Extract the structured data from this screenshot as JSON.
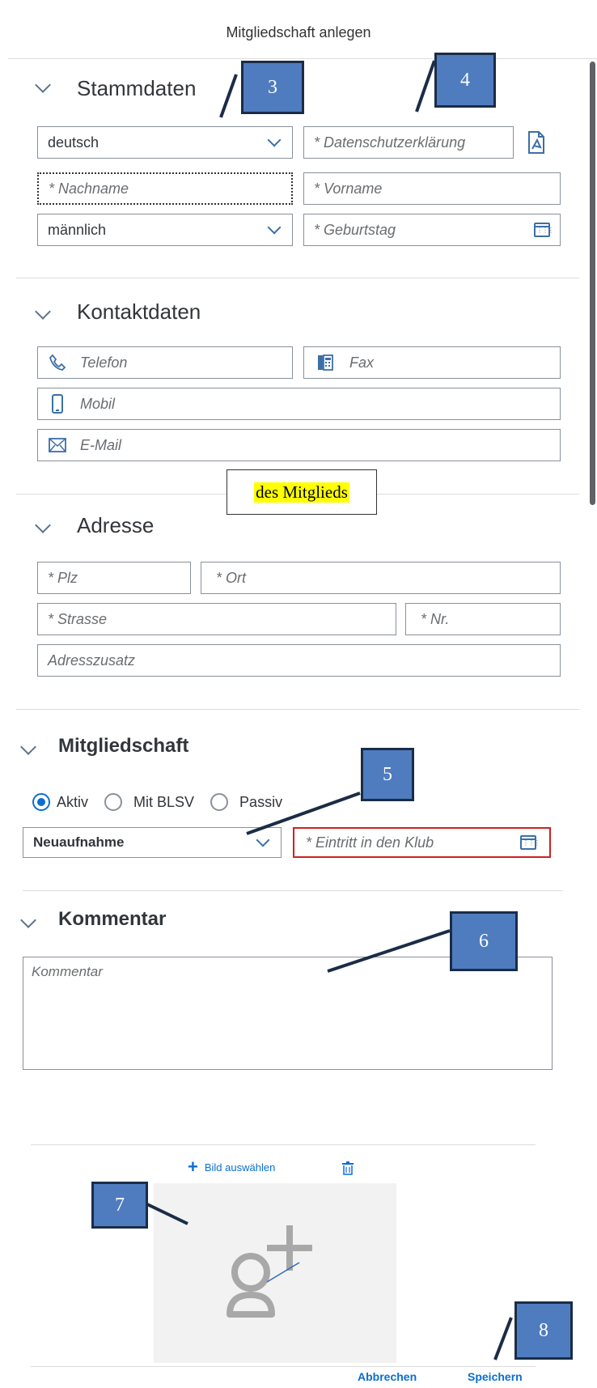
{
  "dialog": {
    "title": "Mitgliedschaft anlegen"
  },
  "stammdaten": {
    "title": "Stammdaten",
    "language": "deutsch",
    "privacy_placeholder": "* Datenschutzerklärung",
    "lastname_placeholder": "* Nachname",
    "firstname_placeholder": "* Vorname",
    "gender": "männlich",
    "birthday_placeholder": "* Geburtstag"
  },
  "kontaktdaten": {
    "title": "Kontaktdaten",
    "phone_placeholder": "Telefon",
    "fax_placeholder": "Fax",
    "mobile_placeholder": "Mobil",
    "email_placeholder": "E-Mail"
  },
  "annotation_note": "des Mitglieds",
  "adresse": {
    "title": "Adresse",
    "plz_placeholder": "* Plz",
    "ort_placeholder": "* Ort",
    "strasse_placeholder": "* Strasse",
    "nr_placeholder": "* Nr.",
    "zusatz_placeholder": "Adresszusatz"
  },
  "mitgliedschaft": {
    "title": "Mitgliedschaft",
    "radios": [
      "Aktiv",
      "Mit BLSV",
      "Passiv"
    ],
    "selected_radio": "Aktiv",
    "type": "Neuaufnahme",
    "entry_placeholder": "* Eintritt in den Klub"
  },
  "kommentar": {
    "title": "Kommentar",
    "placeholder": "Kommentar"
  },
  "image": {
    "select_label": "Bild auswählen"
  },
  "footer": {
    "cancel_label": "Abbrechen",
    "save_label": "Speichern"
  },
  "callouts": [
    "3",
    "4",
    "5",
    "6",
    "7",
    "8"
  ],
  "colors": {
    "accent": "#0a6ed1",
    "callout_fill": "#4f7cbf",
    "error": "#d12020",
    "highlight": "#ffff00"
  }
}
